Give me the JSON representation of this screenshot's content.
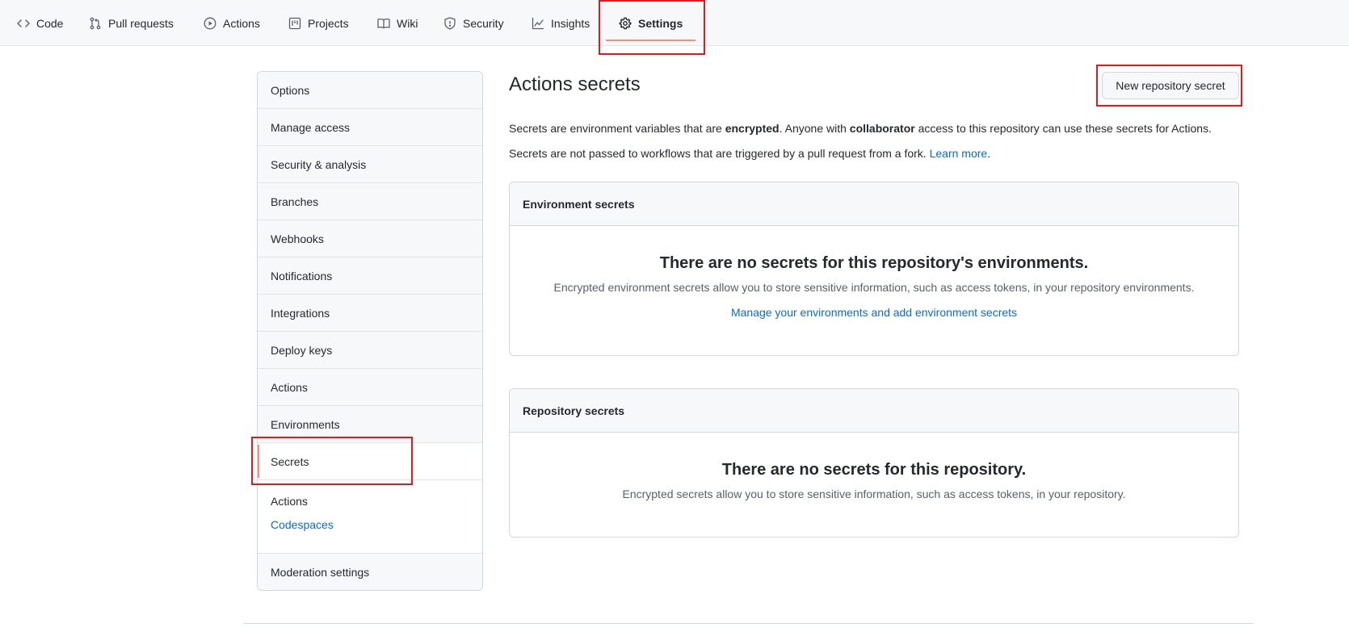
{
  "nav": {
    "tabs": [
      {
        "label": "Code",
        "icon": "code-icon"
      },
      {
        "label": "Pull requests",
        "icon": "git-pull-request-icon"
      },
      {
        "label": "Actions",
        "icon": "play-icon"
      },
      {
        "label": "Projects",
        "icon": "project-icon"
      },
      {
        "label": "Wiki",
        "icon": "book-icon"
      },
      {
        "label": "Security",
        "icon": "shield-icon"
      },
      {
        "label": "Insights",
        "icon": "graph-icon"
      },
      {
        "label": "Settings",
        "icon": "gear-icon",
        "active": true
      }
    ]
  },
  "sidebar": {
    "items": [
      {
        "label": "Options"
      },
      {
        "label": "Manage access"
      },
      {
        "label": "Security & analysis"
      },
      {
        "label": "Branches"
      },
      {
        "label": "Webhooks"
      },
      {
        "label": "Notifications"
      },
      {
        "label": "Integrations"
      },
      {
        "label": "Deploy keys"
      },
      {
        "label": "Actions"
      },
      {
        "label": "Environments"
      },
      {
        "label": "Secrets",
        "selected": true
      }
    ],
    "sub_label": "Actions",
    "sub_link": "Codespaces",
    "last_item": "Moderation settings"
  },
  "main": {
    "title": "Actions secrets",
    "new_secret_button": "New repository secret",
    "desc1": {
      "part1": "Secrets are environment variables that are ",
      "bold1": "encrypted",
      "part2": ". Anyone with ",
      "bold2": "collaborator",
      "part3": " access to this repository can use these secrets for Actions."
    },
    "desc2": {
      "text": "Secrets are not passed to workflows that are triggered by a pull request from a fork. ",
      "link": "Learn more",
      "end": "."
    },
    "env_box": {
      "header": "Environment secrets",
      "title": "There are no secrets for this repository's environments.",
      "text": "Encrypted environment secrets allow you to store sensitive information, such as access tokens, in your repository environments.",
      "link": "Manage your environments and add environment secrets"
    },
    "repo_box": {
      "header": "Repository secrets",
      "title": "There are no secrets for this repository.",
      "text": "Encrypted secrets allow you to store sensitive information, such as access tokens, in your repository."
    }
  },
  "colors": {
    "accent_underline": "#fd8c73",
    "link": "#0969da",
    "highlight": "#e5191b"
  }
}
